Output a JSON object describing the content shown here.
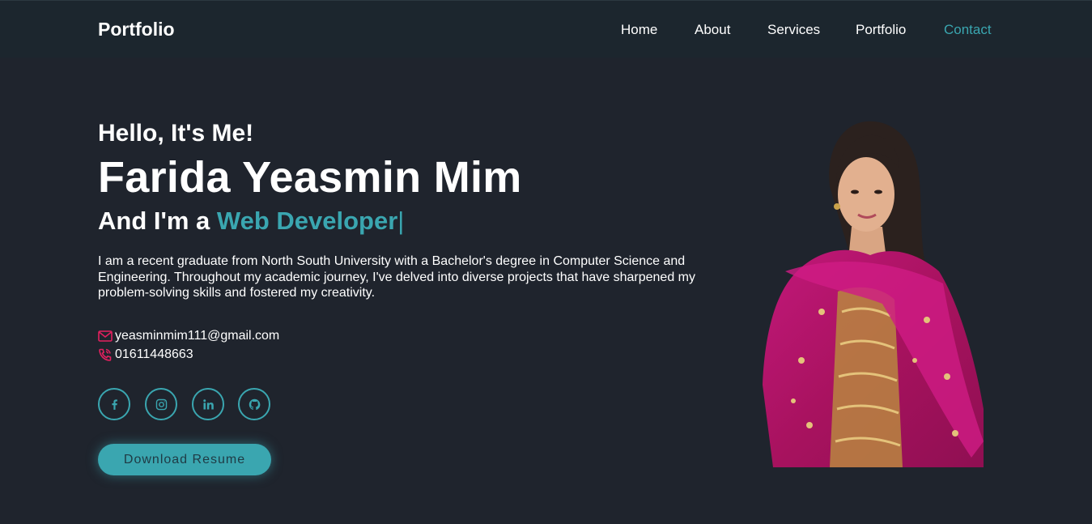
{
  "navbar": {
    "brand": "Portfolio",
    "links": [
      "Home",
      "About",
      "Services",
      "Portfolio",
      "Contact"
    ],
    "active": "Contact"
  },
  "hero": {
    "greeting": "Hello, It's Me!",
    "name": "Farida Yeasmin Mim",
    "role_prefix": "And I'm a",
    "role_highlight": "Web Developer",
    "cursor": "|",
    "bio": "I am a recent graduate from North South University with a Bachelor's degree in Computer Science and Engineering. Throughout my academic journey, I've delved into diverse projects that have sharpened my problem-solving skills and fostered my creativity.",
    "email": "yeasminmim111@gmail.com",
    "phone": "01611448663",
    "socials": [
      "facebook-icon",
      "instagram-icon",
      "linkedin-icon",
      "github-icon"
    ],
    "resume_button": "Download Resume"
  },
  "colors": {
    "background": "#1f242d",
    "navbar": "#1c262e",
    "accent": "#3aa6b0",
    "contact_icon": "#e3205f"
  }
}
